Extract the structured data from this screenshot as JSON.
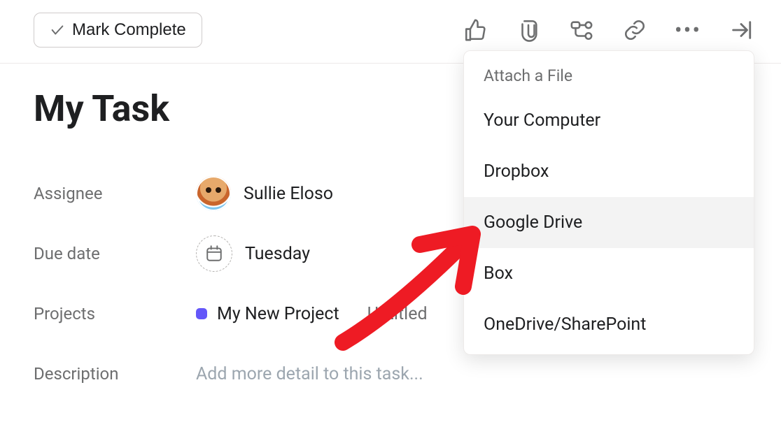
{
  "toolbar": {
    "mark_complete_label": "Mark Complete"
  },
  "task": {
    "title": "My Task"
  },
  "fields": {
    "assignee_label": "Assignee",
    "assignee_name": "Sullie Eloso",
    "due_label": "Due date",
    "due_value": "Tuesday",
    "projects_label": "Projects",
    "project_name": "My New Project",
    "project_section": "Untitled",
    "description_label": "Description",
    "description_placeholder": "Add more detail to this task..."
  },
  "attach_menu": {
    "header": "Attach a File",
    "items": [
      "Your Computer",
      "Dropbox",
      "Google Drive",
      "Box",
      "OneDrive/SharePoint"
    ],
    "highlighted_index": 2
  }
}
